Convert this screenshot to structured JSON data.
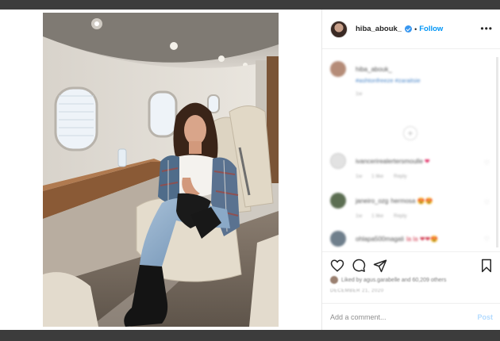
{
  "header": {
    "username": "hiba_abouk_",
    "separator": "•",
    "follow_label": "Follow",
    "more_label": "•••"
  },
  "caption": {
    "username": "hiba_abouk_",
    "text": "#ashtonfreeze #zaraitsie",
    "time": "1w"
  },
  "comments": [
    {
      "username": "ivancerirealertersmoulle",
      "text": "❤",
      "time": "1w",
      "likes": "1 like",
      "reply": "Reply"
    },
    {
      "username": "janeiro_ozg",
      "text": "hermosa 😍😍",
      "time": "1w",
      "likes": "1 like",
      "reply": "Reply"
    },
    {
      "username": "ohlapa500magali",
      "text": "la la ❤❤😍",
      "time": "1w",
      "likes": "",
      "reply": ""
    }
  ],
  "likes_text": "Liked by agus.garabelle and 60,209 others",
  "date_text": "DECEMBER 21, 2020",
  "add_comment": {
    "placeholder": "Add a comment...",
    "post_label": "Post"
  },
  "colors": {
    "follow": "#0095f6",
    "verified": "#3897f0",
    "post_disabled": "#b3dbff"
  },
  "icons": [
    "verified-icon",
    "heart-icon",
    "comment-icon",
    "share-icon",
    "bookmark-icon",
    "more-icon",
    "load-more-icon"
  ]
}
